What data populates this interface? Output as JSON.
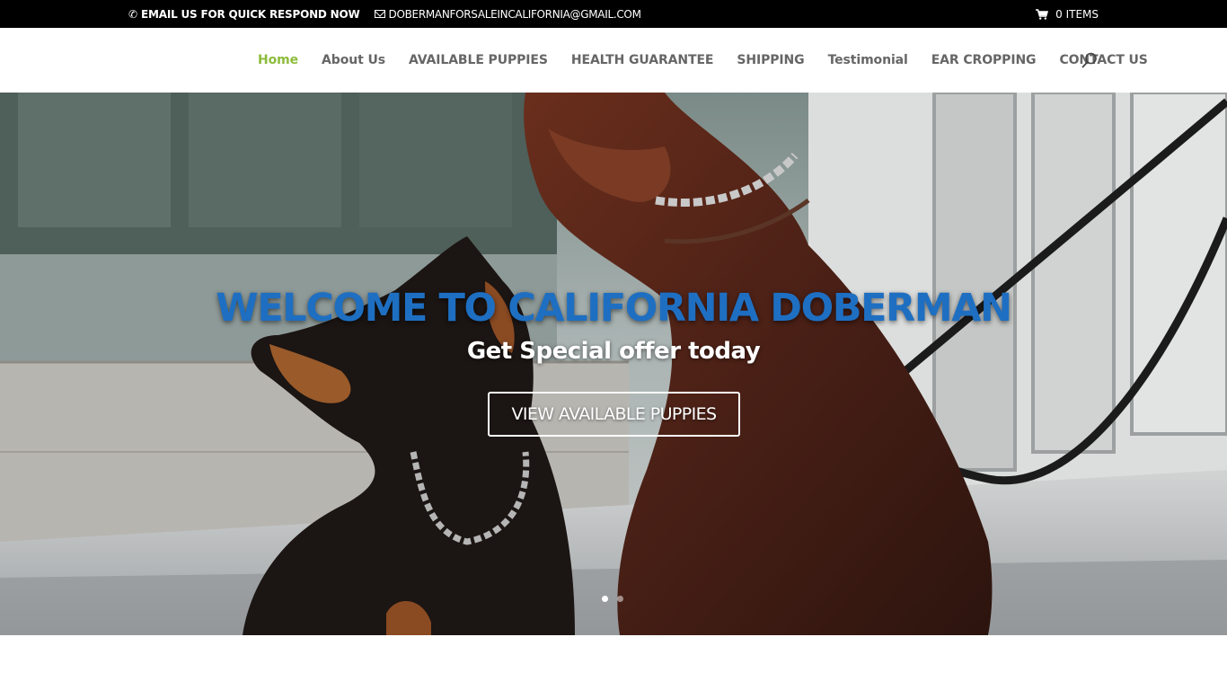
{
  "topbar": {
    "phone_icon": "phone-icon",
    "phone_text": "EMAIL US FOR QUICK RESPOND NOW",
    "email_icon": "envelope-icon",
    "email_text": "DOBERMANFORSALEINCALIFORNIA@GMAIL.COM",
    "cart_icon": "cart-icon",
    "cart_text": "0 ITEMS"
  },
  "nav": {
    "items": [
      {
        "label": "Home",
        "active": true
      },
      {
        "label": "About Us"
      },
      {
        "label": "AVAILABLE PUPPIES"
      },
      {
        "label": "HEALTH GUARANTEE"
      },
      {
        "label": "SHIPPING"
      },
      {
        "label": "Testimonial"
      },
      {
        "label": "EAR CROPPING"
      },
      {
        "label": "CONTACT US"
      }
    ],
    "search_icon": "search-icon"
  },
  "hero": {
    "title": "WELCOME TO CALIFORNIA DOBERMAN",
    "subtitle": "Get Special offer today",
    "button_label": "VIEW AVAILABLE PUPPIES",
    "slides": 2,
    "active_slide": 1
  },
  "colors": {
    "accent": "#8dbc3c",
    "title_blue": "#1e6fc2",
    "topbar_bg": "#000000",
    "nav_text": "#666666"
  }
}
